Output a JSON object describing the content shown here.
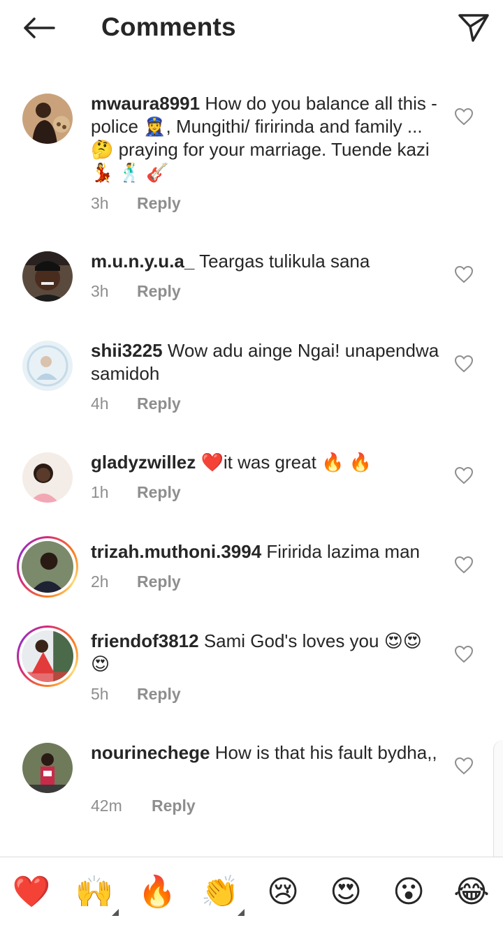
{
  "header": {
    "title": "Comments",
    "back_icon": "arrow-left-icon",
    "share_icon": "paper-plane-icon"
  },
  "comments": [
    {
      "username": "mwaura8991",
      "text": " How do you balance all this -police 👮‍♀️, Mungithi/ firirinda and family ... 🤔  praying for your marriage. Tuende kazi 💃 🕺 🎸",
      "time": "3h",
      "reply": "Reply"
    },
    {
      "username": "m.u.n.y.u.a_",
      "text": " Teargas tulikula sana",
      "time": "3h",
      "reply": "Reply"
    },
    {
      "username": "shii3225",
      "text": " Wow adu ainge Ngai! unapendwa samidoh",
      "time": "4h",
      "reply": "Reply"
    },
    {
      "username": "gladyzwillez",
      "text": " ❤️it was great 🔥 🔥",
      "time": "1h",
      "reply": "Reply"
    },
    {
      "username": "trizah.muthoni.3994",
      "text": " Firirida lazima man",
      "time": "2h",
      "reply": "Reply"
    },
    {
      "username": "friendof3812",
      "text": " Sami God's loves you 😍😍😍",
      "time": "5h",
      "reply": "Reply"
    },
    {
      "username": "nourinechege",
      "text": " How is that his fault bydha,,",
      "time": "42m",
      "reply": "Reply"
    }
  ],
  "emoji_bar": [
    "❤️",
    "🙌",
    "🔥",
    "👏",
    "😢",
    "😍",
    "😮",
    "😂"
  ],
  "colors": {
    "text": "#262626",
    "secondary": "#8e8e8e",
    "heart_red": "#ed4956"
  }
}
